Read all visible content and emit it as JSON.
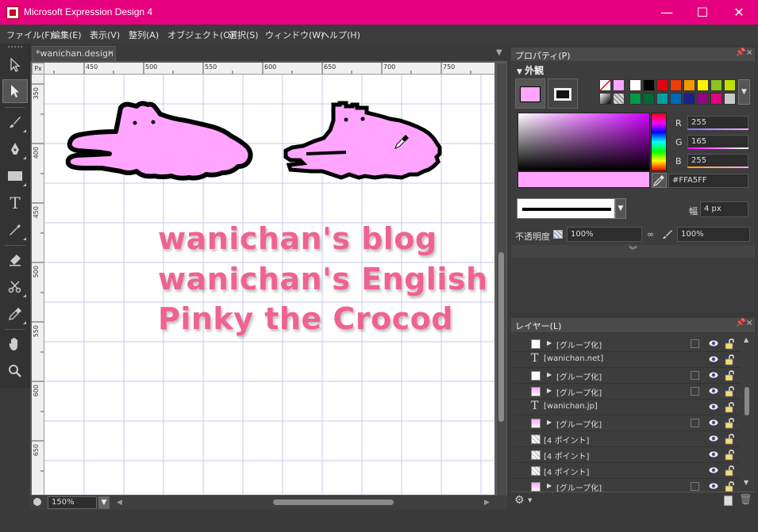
{
  "window": {
    "title": "Microsoft Expression Design 4",
    "minimize": "—",
    "maximize": "☐",
    "close": "✕"
  },
  "menu": [
    "ファイル(F)",
    "編集(E)",
    "表示(V)",
    "整列(A)",
    "オブジェクト(O)",
    "選択(S)",
    "ウィンドウ(W)",
    "ヘルプ(H)"
  ],
  "document": {
    "tab_label": "*wanichan.design",
    "ruler_unit": "Px",
    "ruler_top": [
      "450",
      "500",
      "550",
      "600",
      "650",
      "700",
      "750"
    ],
    "ruler_left": [
      "350",
      "400",
      "450",
      "500",
      "550",
      "600",
      "650"
    ],
    "text_lines": [
      "wanichan's blog",
      "wanichan's English b",
      "Pinky the Crocod"
    ],
    "zoom": "150%",
    "crocodile_fill": "#ffa5ff"
  },
  "properties": {
    "panel_title": "プロパティ(P)",
    "section": "外観",
    "color": {
      "r": 255,
      "g": 165,
      "b": 255,
      "r_label": "R",
      "g_label": "G",
      "b_label": "B",
      "hex": "#FFA5FF"
    },
    "stroke_width_label": "幅",
    "stroke_width": "4 px",
    "opacity_label": "不透明度",
    "opacity": "100%",
    "fill_opacity": "100%",
    "palette": [
      "#ffffff",
      "#000000",
      "#e60012",
      "#f03c00",
      "#f39800",
      "#fff100",
      "#8fc31f",
      "#c0e000",
      "#009944",
      "#006934",
      "#00a0a0",
      "#0068b7",
      "#1d2088",
      "#920783",
      "#e4007f",
      "#c8c8c8"
    ]
  },
  "layers": {
    "panel_title": "レイヤー(L)",
    "rows": [
      {
        "name": "[グループ化]",
        "type": "group"
      },
      {
        "name": "[wanichan.net]",
        "type": "text"
      },
      {
        "name": "[グループ化]",
        "type": "group"
      },
      {
        "name": "[グループ化]",
        "type": "group-color"
      },
      {
        "name": "[wanichan.jp]",
        "type": "text"
      },
      {
        "name": "[グループ化]",
        "type": "group-color"
      },
      {
        "name": "[4 ポイント]",
        "type": "points"
      },
      {
        "name": "[4 ポイント]",
        "type": "points"
      },
      {
        "name": "[4 ポイント]",
        "type": "points"
      },
      {
        "name": "[グループ化]",
        "type": "group-color"
      }
    ]
  },
  "icons": {
    "pin": "pin-icon",
    "close": "close-icon",
    "eye": "eye-icon",
    "lock": "lock-icon",
    "settings": "gear-icon"
  }
}
